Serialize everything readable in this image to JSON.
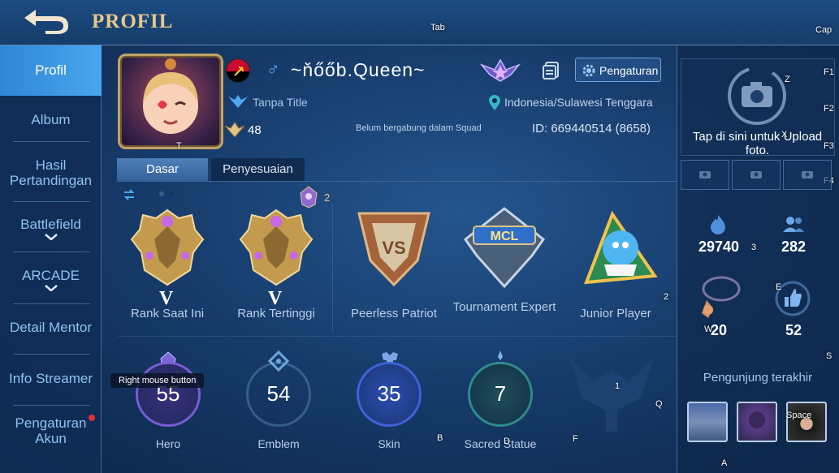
{
  "header": {
    "title": "PROFIL",
    "back_icon": "back-arrow-icon"
  },
  "key_hints": {
    "tab": "Tab",
    "cap": "Cap",
    "f1": "F1",
    "f2": "F2",
    "f3": "F3",
    "f4": "F4",
    "z": "Z",
    "x": "X",
    "t": "T",
    "two": "2",
    "three": "3",
    "e": "E",
    "w": "W",
    "s": "S",
    "one": "1",
    "q": "Q",
    "b": "B",
    "d": "D",
    "f": "F",
    "a": "A",
    "space": "Space",
    "rmb": "Right mouse button"
  },
  "sidebar": {
    "items": [
      {
        "label": "Profil",
        "active": true
      },
      {
        "label": "Album"
      },
      {
        "label": "Hasil Pertandingan"
      },
      {
        "label": "Battlefield"
      },
      {
        "label": "ARCADE"
      },
      {
        "label": "Detail Mentor"
      },
      {
        "label": "Info Streamer"
      },
      {
        "label": "Pengaturan Akun"
      }
    ]
  },
  "profile": {
    "name": "~ňőőb.Queen~",
    "gender_symbol": "♂",
    "title": "Tanpa Title",
    "level": "48",
    "squad": "Belum bergabung dalam Squad",
    "location": "Indonesia/Sulawesi Tenggara",
    "id": "ID: 669440514 (8658)",
    "settings_label": "Pengaturan",
    "flag_colors": [
      "#cc092f",
      "#000000",
      "#f9d616"
    ]
  },
  "tabs": {
    "dasar": "Dasar",
    "penyesuaian": "Penyesuaian"
  },
  "achievements": {
    "counter": "2",
    "badges": [
      {
        "label": "Rank Saat Ini",
        "tier": "V",
        "icon": "mythic-rank-icon"
      },
      {
        "label": "Rank Tertinggi",
        "tier": "V",
        "icon": "mythic-rank-icon"
      },
      {
        "label": "Peerless Patriot",
        "icon": "patriot-shield-icon"
      },
      {
        "label": "Tournament Expert",
        "icon": "mcl-badge-icon"
      },
      {
        "label": "Junior Player",
        "icon": "junior-player-icon"
      }
    ]
  },
  "stats": [
    {
      "label": "Hero",
      "value": "55",
      "color": "#7a5cd6"
    },
    {
      "label": "Emblem",
      "value": "54",
      "color": "#6aa8d8"
    },
    {
      "label": "Skin",
      "value": "35",
      "color": "#3e63d6"
    },
    {
      "label": "Sacred Statue",
      "value": "7",
      "color": "#2f8a8a"
    }
  ],
  "right_panel": {
    "upload_text": "Tap di sini untuk Upload foto.",
    "popularity": "29740",
    "followers": "282",
    "charm": "20",
    "likes": "52",
    "visitors_label": "Pengunjung terakhir"
  }
}
